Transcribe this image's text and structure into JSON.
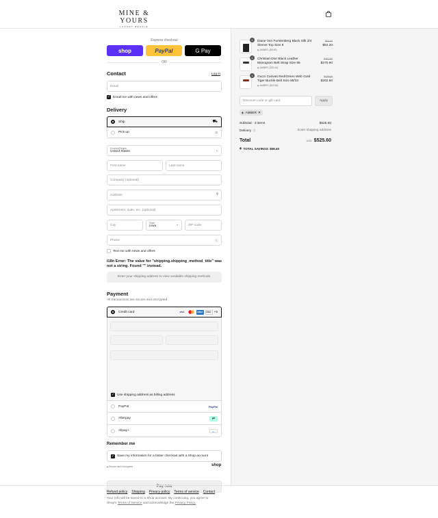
{
  "header": {
    "brand": "MINE & YOURS",
    "tagline": "LUXURY RESALE",
    "cart_icon": "shopping-bag-icon"
  },
  "express": {
    "label": "Express checkout",
    "shop_label": "shop",
    "paypal_label": "PayPal",
    "gpay_label": "G Pay",
    "or": "OR"
  },
  "contact": {
    "title": "Contact",
    "login": "Log in",
    "email_placeholder": "Email",
    "news_label": "Email me with news and offers"
  },
  "delivery": {
    "title": "Delivery",
    "ship_label": "Ship",
    "pickup_label": "Pick up",
    "country_label": "Country/Region",
    "country_value": "United States",
    "first_name": "First name",
    "last_name": "Last name",
    "company": "Company (optional)",
    "address": "Address",
    "apartment": "Apartment, suite, etc. (optional)",
    "city": "City",
    "state_label": "State",
    "state_value": "Iowa",
    "zip": "ZIP code",
    "phone": "Phone",
    "text_label": "Text me with news and offers",
    "error_text": "I18n Error: The value for \"shipping.shipping_method_title\" was not a string. Found \"\" instead.",
    "shipping_note": "Enter your shipping address to view available shipping methods."
  },
  "payment": {
    "title": "Payment",
    "subtitle": "All transactions are secure and encrypted.",
    "credit_card": "Credit card",
    "more_cards": "+5",
    "billing_label": "Use shipping address as billing address",
    "paypal": "PayPal",
    "afterpay": "Afterpay",
    "alipay": "Alipay+"
  },
  "remember": {
    "title": "Remember me",
    "save_label": "Save my information for a faster checkout with a Shop account",
    "secure": "Secure and encrypted",
    "shop": "shop"
  },
  "pay": {
    "button": "Pay now",
    "legal_1": "Your info will be saved to a Shop account. By continuing, you agree to",
    "legal_2a": "Shop's",
    "terms": "Terms of Service",
    "legal_2b": "and acknowledge the",
    "privacy": "Privacy Policy."
  },
  "footer": {
    "links": [
      "Refund policy",
      "Shipping",
      "Privacy policy",
      "Terms of service",
      "Contact"
    ]
  },
  "cart": {
    "items": [
      {
        "qty": "1",
        "name_1": "Diane Von Furstenberg Black Silk 3/4",
        "name_2": "Sleeve Top Size 8",
        "discount": "AMBER (-$9.80)",
        "old_price": "$62.00",
        "price": "$52.20"
      },
      {
        "qty": "1",
        "name_1": "Christian Dior Black Leather",
        "name_2": "Monogram Belt Strap Size 95",
        "discount": "AMBER (-$30.10)",
        "old_price": "$301.00",
        "price": "$270.90"
      },
      {
        "qty": "1",
        "name_1": "Gucci Canvas Red/Green Web Gold",
        "name_2": "Tiger Buckle Belt Size 85/34",
        "discount": "AMBER (-$22.50)",
        "old_price": "$225.00",
        "price": "$202.50"
      }
    ],
    "discount_placeholder": "Discount code or gift card",
    "apply": "Apply",
    "code_tag": "AMBER",
    "subtotal_label": "Subtotal · 3 items",
    "subtotal": "$525.60",
    "delivery_label": "Delivery",
    "delivery_value": "Enter shipping address",
    "total_label": "Total",
    "currency": "USD",
    "total": "$525.60",
    "savings_label": "TOTAL SAVINGS",
    "savings": "$58.40"
  }
}
